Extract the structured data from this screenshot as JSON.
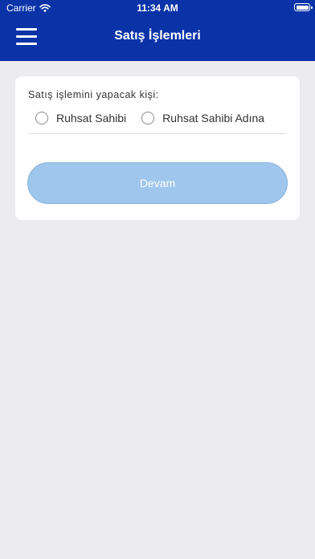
{
  "status_bar": {
    "carrier": "Carrier",
    "time": "11:34 AM"
  },
  "nav": {
    "title": "Satış İşlemleri",
    "menu_icon": "hamburger-menu-icon"
  },
  "form": {
    "question": "Satış işlemini yapacak kişi:",
    "options": [
      {
        "label": "Ruhsat Sahibi",
        "selected": false
      },
      {
        "label": "Ruhsat Sahibi Adına",
        "selected": false
      }
    ],
    "continue_label": "Devam"
  },
  "colors": {
    "header": "#0a33a8",
    "background": "#ebebf0",
    "button": "#9fc6ec"
  }
}
